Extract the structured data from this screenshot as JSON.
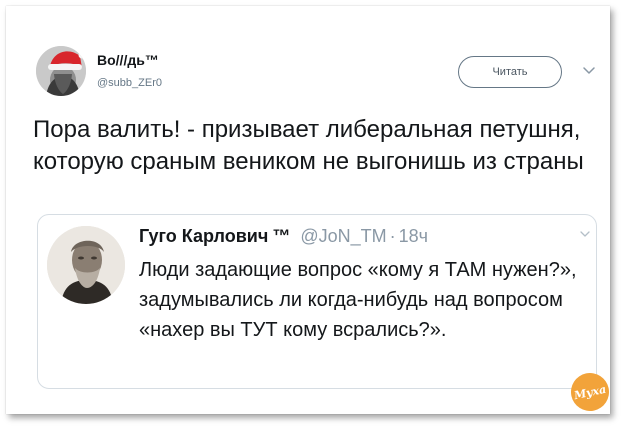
{
  "author": {
    "name": "Во///дь™",
    "handle": "@subb_ZEr0",
    "avatar_icon": "avatar-santa-hat-icon"
  },
  "follow_button": {
    "label": "Читать"
  },
  "menu": {
    "icon": "chevron-down-icon"
  },
  "tweet": {
    "text": "Пора валить! - призывает либеральная петушня, которую сраным веником не выгонишь из страны"
  },
  "quote": {
    "name": "Гуго Карлович",
    "mark": "™",
    "handle": "@JoN_TM",
    "separator": "·",
    "time": "18ч",
    "text": "Люди задающие вопрос «кому я ТАМ нужен?», задумывались ли когда-нибудь над вопросом «нахер вы ТУТ кому всрались?».",
    "avatar_icon": "portrait-photo-icon"
  },
  "watermark": {
    "text": "Муха"
  },
  "colors": {
    "text_primary": "#14171a",
    "text_secondary": "#657786",
    "border": "#d6dde3",
    "watermark": "#f2a33a"
  }
}
